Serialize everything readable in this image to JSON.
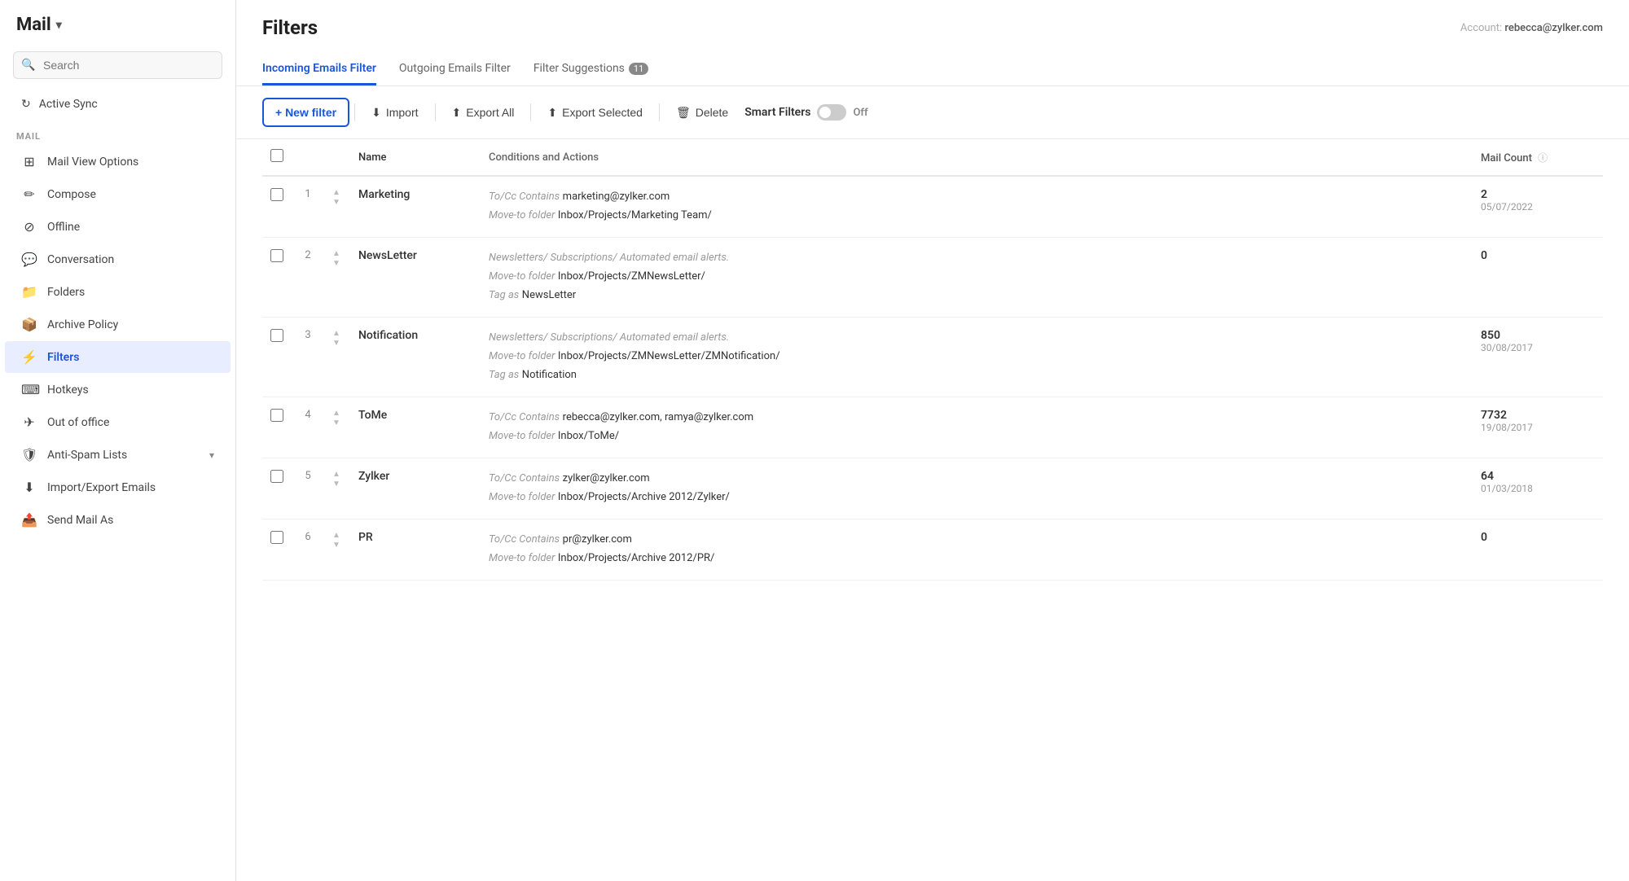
{
  "sidebar": {
    "title": "Mail",
    "search_placeholder": "Search",
    "active_sync": "Active Sync",
    "section_label": "MAIL",
    "nav_items": [
      {
        "id": "mail-view-options",
        "label": "Mail View Options",
        "icon": "grid"
      },
      {
        "id": "compose",
        "label": "Compose",
        "icon": "edit"
      },
      {
        "id": "offline",
        "label": "Offline",
        "icon": "wifi-off"
      },
      {
        "id": "conversation",
        "label": "Conversation",
        "icon": "message"
      },
      {
        "id": "folders",
        "label": "Folders",
        "icon": "folder"
      },
      {
        "id": "archive-policy",
        "label": "Archive Policy",
        "icon": "archive"
      },
      {
        "id": "filters",
        "label": "Filters",
        "icon": "filter",
        "active": true
      },
      {
        "id": "hotkeys",
        "label": "Hotkeys",
        "icon": "keyboard"
      },
      {
        "id": "out-of-office",
        "label": "Out of office",
        "icon": "plane"
      },
      {
        "id": "anti-spam",
        "label": "Anti-Spam Lists",
        "icon": "shield",
        "has_caret": true
      },
      {
        "id": "import-export",
        "label": "Import/Export Emails",
        "icon": "download"
      },
      {
        "id": "send-mail-as",
        "label": "Send Mail As",
        "icon": "send"
      }
    ]
  },
  "header": {
    "title": "Filters",
    "account_label": "Account:",
    "account_email": "rebecca@zylker.com"
  },
  "tabs": [
    {
      "id": "incoming",
      "label": "Incoming Emails Filter",
      "active": true
    },
    {
      "id": "outgoing",
      "label": "Outgoing Emails Filter"
    },
    {
      "id": "suggestions",
      "label": "Filter Suggestions",
      "badge": "11"
    }
  ],
  "toolbar": {
    "new_filter": "+ New filter",
    "import": "Import",
    "export_all": "Export All",
    "export_selected": "Export Selected",
    "delete": "Delete",
    "smart_filters": "Smart Filters",
    "toggle_state": "Off"
  },
  "table": {
    "columns": {
      "name": "Name",
      "conditions": "Conditions and Actions",
      "mail_count": "Mail Count"
    },
    "rows": [
      {
        "num": 1,
        "name": "Marketing",
        "conditions": [
          {
            "key": "To/Cc Contains",
            "val": "marketing@zylker.com"
          },
          {
            "key": "Move-to folder",
            "val": "Inbox/Projects/Marketing Team/"
          }
        ],
        "count": "2",
        "date": "05/07/2022"
      },
      {
        "num": 2,
        "name": "NewsLetter",
        "conditions": [
          {
            "note": "Newsletters/ Subscriptions/ Automated email alerts."
          },
          {
            "key": "Move-to folder",
            "val": "Inbox/Projects/ZMNewsLetter/"
          },
          {
            "key": "Tag as",
            "val": "NewsLetter"
          }
        ],
        "count": "0",
        "date": ""
      },
      {
        "num": 3,
        "name": "Notification",
        "conditions": [
          {
            "note": "Newsletters/ Subscriptions/ Automated email alerts."
          },
          {
            "key": "Move-to folder",
            "val": "Inbox/Projects/ZMNewsLetter/ZMNotification/"
          },
          {
            "key": "Tag as",
            "val": "Notification"
          }
        ],
        "count": "850",
        "date": "30/08/2017"
      },
      {
        "num": 4,
        "name": "ToMe",
        "conditions": [
          {
            "key": "To/Cc Contains",
            "val": "rebecca@zylker.com, ramya@zylker.com"
          },
          {
            "key": "Move-to folder",
            "val": "Inbox/ToMe/"
          }
        ],
        "count": "7732",
        "date": "19/08/2017"
      },
      {
        "num": 5,
        "name": "Zylker",
        "conditions": [
          {
            "key": "To/Cc Contains",
            "val": "zylker@zylker.com"
          },
          {
            "key": "Move-to folder",
            "val": "Inbox/Projects/Archive 2012/Zylker/"
          }
        ],
        "count": "64",
        "date": "01/03/2018"
      },
      {
        "num": 6,
        "name": "PR",
        "conditions": [
          {
            "key": "To/Cc Contains",
            "val": "pr@zylker.com"
          },
          {
            "key": "Move-to folder",
            "val": "Inbox/Projects/Archive 2012/PR/"
          }
        ],
        "count": "0",
        "date": ""
      }
    ]
  }
}
